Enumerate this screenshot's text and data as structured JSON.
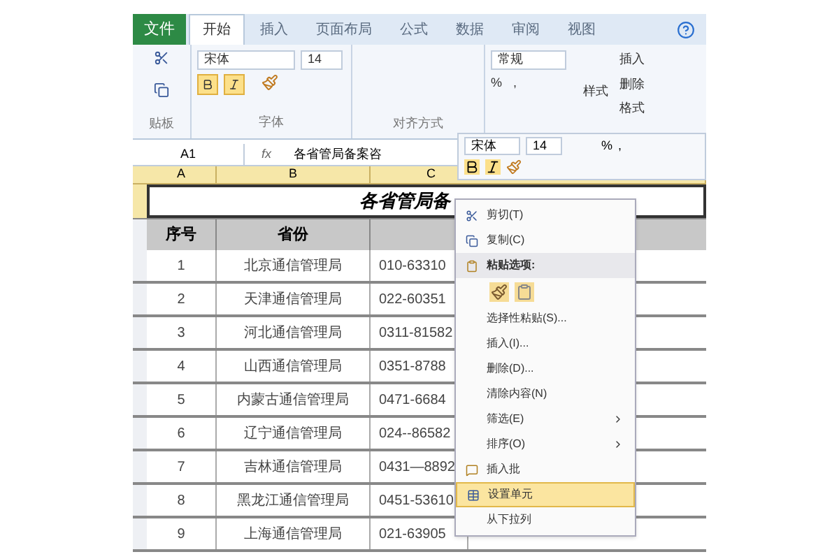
{
  "ribbon_tabs": [
    {
      "label": "文件",
      "selected": false,
      "kind": "file"
    },
    {
      "label": "开始",
      "selected": true,
      "kind": "tab"
    },
    {
      "label": "插入",
      "selected": false,
      "kind": "tab"
    },
    {
      "label": "页面布局",
      "selected": false,
      "kind": "tab"
    },
    {
      "label": "公式",
      "selected": false,
      "kind": "tab"
    },
    {
      "label": "数据",
      "selected": false,
      "kind": "tab"
    },
    {
      "label": "审阅",
      "selected": false,
      "kind": "tab"
    },
    {
      "label": "视图",
      "selected": false,
      "kind": "tab"
    }
  ],
  "ribbon": {
    "font_name": "宋体",
    "font_size": "14",
    "bold": true,
    "italic": true,
    "number_format": "常规",
    "percent": "%",
    "comma": ",",
    "styles": "样式",
    "cells_buttons": [
      "插入",
      "删除",
      "格式"
    ],
    "group_labels": [
      "贴板",
      "字体",
      "对齐方式"
    ]
  },
  "formula_bar": {
    "name_box": "A1",
    "fx": "fx",
    "formula": "各省管局备案咨"
  },
  "mini_toolbar": {
    "font_name": "宋体",
    "font_size": "14",
    "percent": "%",
    "comma": ","
  },
  "sheet": {
    "columns": [
      "A",
      "B",
      "C"
    ],
    "title": "各省管局备",
    "header": [
      "序号",
      "省份"
    ],
    "rows": [
      [
        "1",
        "北京通信管理局",
        "010-63310"
      ],
      [
        "2",
        "天津通信管理局",
        "022-60351"
      ],
      [
        "3",
        "河北通信管理局",
        "0311-81582"
      ],
      [
        "4",
        "山西通信管理局",
        "0351-8788"
      ],
      [
        "5",
        "内蒙古通信管理局",
        "0471-6684"
      ],
      [
        "6",
        "辽宁通信管理局",
        "024--86582"
      ],
      [
        "7",
        "吉林通信管理局",
        "0431—8892"
      ],
      [
        "8",
        "黑龙江通信管理局",
        "0451-53610"
      ],
      [
        "9",
        "上海通信管理局",
        "021-63905"
      ]
    ]
  },
  "context_menu": [
    {
      "label": "剪切(T)",
      "kind": "cut",
      "selected": false
    },
    {
      "label": "复制(C)",
      "kind": "copy",
      "selected": false
    },
    {
      "label": "粘贴选项:",
      "kind": "heading",
      "selected": false
    },
    {
      "kind": "paste_icons"
    },
    {
      "label": "选择性粘贴(S)...",
      "kind": "item",
      "selected": false
    },
    {
      "label": "插入(I)...",
      "kind": "item",
      "selected": false
    },
    {
      "label": "删除(D)...",
      "kind": "item",
      "selected": false
    },
    {
      "label": "清除内容(N)",
      "kind": "item",
      "selected": false
    },
    {
      "label": "筛选(E)",
      "kind": "submenu",
      "selected": false
    },
    {
      "label": "排序(O)",
      "kind": "submenu",
      "selected": false
    },
    {
      "label": "插入批",
      "kind": "comment",
      "selected": false
    },
    {
      "label": "设置单元",
      "kind": "format",
      "selected": true
    },
    {
      "label": "从下拉列",
      "kind": "item",
      "selected": false
    }
  ]
}
